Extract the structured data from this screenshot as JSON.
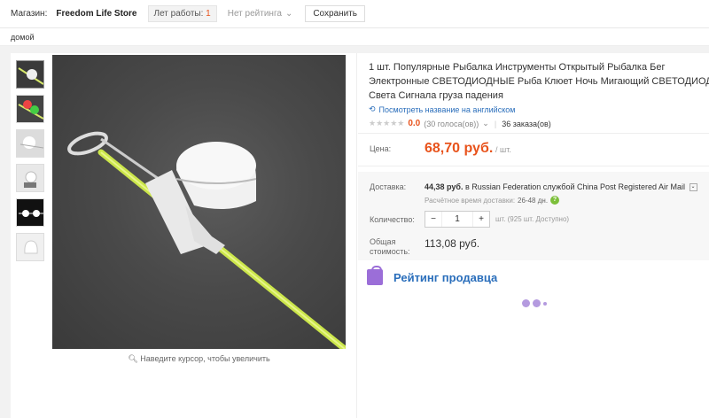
{
  "topbar": {
    "store_label": "Магазин:",
    "store_name": "Freedom Life Store",
    "years_label": "Лет работы:",
    "years_value": "1",
    "rating_text": "Нет рейтинга",
    "save_label": "Сохранить"
  },
  "breadcrumb": "домой",
  "gallery": {
    "zoom_hint": "Наведите курсор, чтобы увеличить"
  },
  "product": {
    "title": "1 шт. Популярные Рыбалка Инструменты Открытый Рыбалка Бег Электронные СВЕТОДИОДНЫЕ Рыба Клюет Ночь Мигающий СВЕТОДИОД Света Сигнала груза падения",
    "translate_link": "Посмотреть название на английском",
    "rating_score": "0.0",
    "votes": "(30 голоса(ов))",
    "orders": "36 заказа(ов)",
    "price_label": "Цена:",
    "price": "68,70 руб.",
    "price_unit": "/ шт.",
    "shipping_label": "Доставка:",
    "shipping_price": "44,38 руб.",
    "shipping_text": "в Russian Federation службой China Post Registered Air Mail",
    "delivery_label": "Расчётное время доставки:",
    "delivery_days": "26-48 дн.",
    "quantity_label": "Количество:",
    "quantity_value": "1",
    "quantity_minus": "−",
    "quantity_plus": "+",
    "quantity_available": "шт. (925 шт. Доступно)",
    "total_label_1": "Общая",
    "total_label_2": "стоимость:",
    "total": "113,08 руб."
  },
  "seller": {
    "title": "Рейтинг продавца"
  },
  "colors": {
    "price": "#e8531c",
    "link": "#2a6ebb",
    "accent_purple": "#9b6ed8"
  }
}
